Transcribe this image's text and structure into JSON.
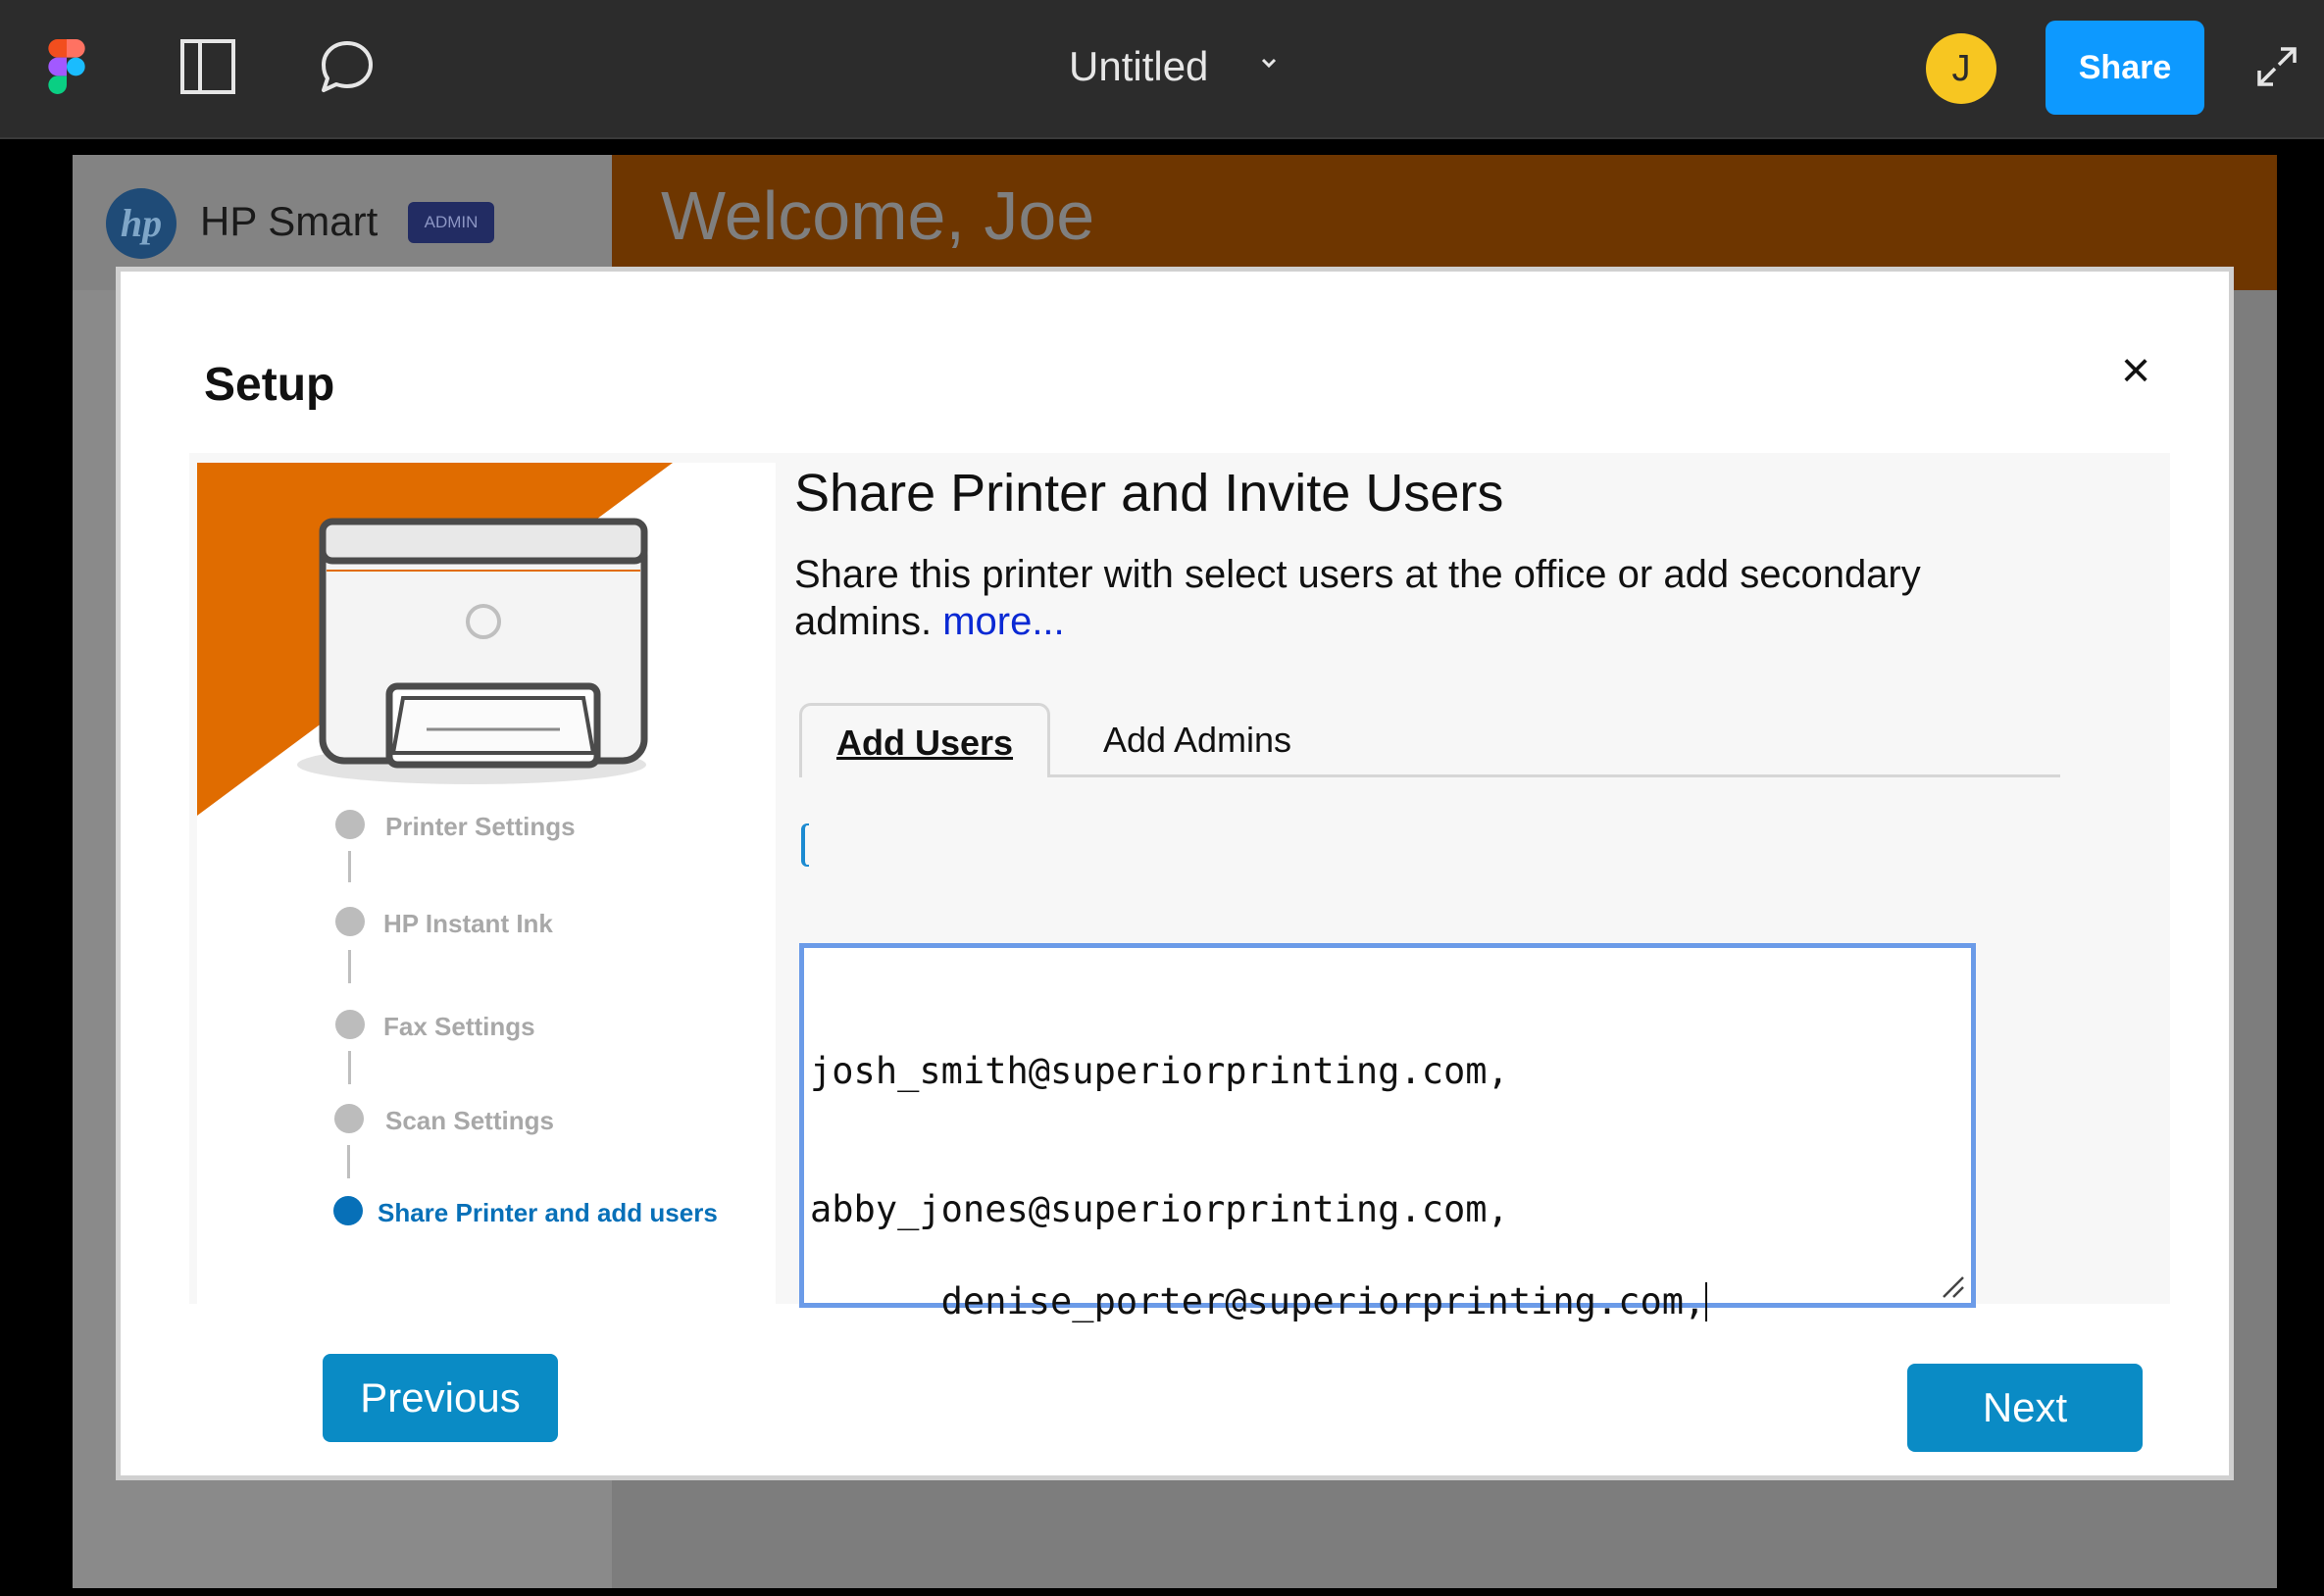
{
  "topbar": {
    "title": "Untitled",
    "avatar_initial": "J",
    "share_label": "Share",
    "icons": [
      "figma-logo-icon",
      "sidebar-panel-icon",
      "comment-icon",
      "chevron-down-icon",
      "expand-icon"
    ],
    "colors": {
      "bar": "#2c2c2c",
      "share": "#0d99ff",
      "avatar": "#f7c621"
    }
  },
  "app": {
    "logo_text": "hp",
    "name": "HP Smart",
    "badge": "ADMIN",
    "welcome": "Welcome, Joe",
    "colors": {
      "header": "#6e3600",
      "badge": "#222c63"
    }
  },
  "modal": {
    "title": "Setup",
    "close_icon": "close-icon",
    "steps": [
      {
        "label": "Printer Settings",
        "active": false
      },
      {
        "label": "HP Instant Ink",
        "active": false
      },
      {
        "label": "Fax Settings",
        "active": false
      },
      {
        "label": "Scan Settings",
        "active": false
      },
      {
        "label": "Share Printer and add users",
        "active": true
      }
    ],
    "heading": "Share Printer and Invite Users",
    "description": "Share this printer with select users at the office or add secondary admins.",
    "more_link": "more...",
    "tabs": [
      {
        "label": "Add Users",
        "active": true
      },
      {
        "label": "Add Admins",
        "active": false
      }
    ],
    "emails": [
      "josh_smith@superiorprinting.com,",
      "abby_jones@superiorprinting.com,",
      "denise_porter@superiorprinting.com,"
    ],
    "previous_label": "Previous",
    "next_label": "Next",
    "colors": {
      "accent": "#0a8bc5",
      "orange": "#e06c00",
      "active_step": "#0770b8",
      "link": "#0a29d4"
    }
  }
}
